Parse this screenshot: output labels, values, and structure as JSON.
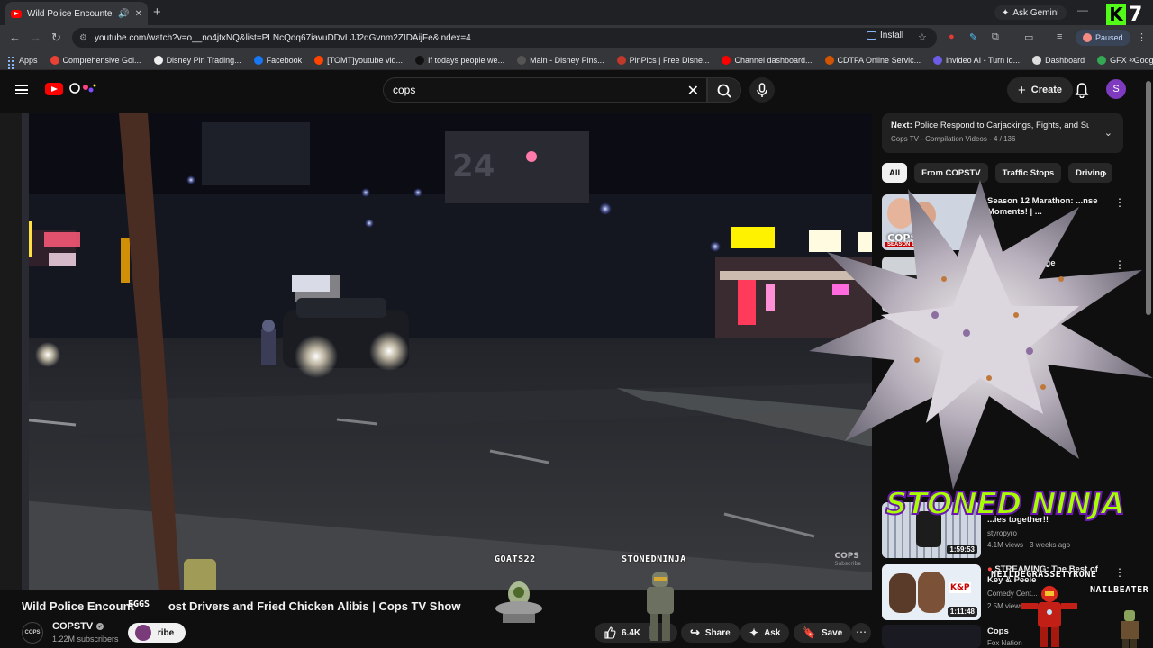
{
  "browser": {
    "tab_title": "Wild Police Encounters: Gh",
    "gemini_label": "Ask Gemini",
    "url": "youtube.com/watch?v=o__no4jtxNQ&list=PLNcQdq67iavuDDvLJJ2qGvnm2ZIDAijFe&index=4",
    "install_label": "Install",
    "paused_label": "Paused",
    "kick_count": "7",
    "bookmarks": [
      {
        "label": "Apps"
      },
      {
        "label": "Comprehensive Gol...",
        "color": "#e94235"
      },
      {
        "label": "Disney Pin Trading...",
        "color": "#eeeeee"
      },
      {
        "label": "Facebook",
        "color": "#1877f2"
      },
      {
        "label": "[TOMT]youtube vid...",
        "color": "#ff4500"
      },
      {
        "label": "If todays people we...",
        "color": "#111111"
      },
      {
        "label": "Main - Disney Pins...",
        "color": "#555555"
      },
      {
        "label": "PinPics | Free Disne...",
        "color": "#c0392b"
      },
      {
        "label": "Channel dashboard...",
        "color": "#ff0000"
      },
      {
        "label": "CDTFA Online Servic...",
        "color": "#d35400"
      },
      {
        "label": "invideo AI - Turn id...",
        "color": "#6c5ce7"
      },
      {
        "label": "Dashboard",
        "color": "#dddddd"
      },
      {
        "label": "GFX - Google Drive",
        "color": "#34a853"
      }
    ]
  },
  "youtube": {
    "search_query": "cops",
    "create_label": "Create",
    "avatar_letter": "S"
  },
  "video": {
    "title": "Wild Police Encounters: Ghost Drivers and Fried Chicken Alibis | Cops Tv Show",
    "title_display": "Wild Police Encount",
    "title_display_rest": "ost Drivers and Fried Chicken Alibis | Cops TV Show",
    "watermark": "COPS",
    "watermark_sub": "Subscribe",
    "channel_avatar_text": "COPS",
    "channel": "COPSTV",
    "subscribers": "1.22M subscribers",
    "subscribe_label": "ribe",
    "likes": "6.4K",
    "share_label": "Share",
    "ask_label": "Ask",
    "save_label": "Save"
  },
  "playlist": {
    "next_prefix": "Next:",
    "next_title": "Police Respond to Carjackings, Fights, and Su...",
    "subtitle": "Cops TV - Compilation Videos - 4 / 136"
  },
  "chips": [
    "All",
    "From COPSTV",
    "Traffic Stops",
    "Driving"
  ],
  "recommendations": [
    {
      "title": "Season 12 Marathon: ...nse Moments! | ...",
      "thumb_text": "COPS",
      "thumb_sub": "SEASON 12"
    },
    {
      "title": "Extreme ...llenge"
    },
    {
      "title": "...ies together!!",
      "channel": "styropyro",
      "meta": "4.1M views · 3 weeks ago",
      "duration": "1:59:53"
    },
    {
      "title": "STREAMING: The Best of Key & Peele",
      "channel": "Comedy Cent...",
      "meta": "2.5M views · ...ars ago",
      "duration": "1:11:48",
      "thumb_text": "K&P"
    },
    {
      "title": "Cops",
      "channel": "Fox Nation"
    }
  ],
  "overlays": {
    "banner": "STONED NINJA",
    "stoned_name": "STONEDNINJA",
    "goat_name": "GOATS22",
    "neil_name": "NEILDEGRASSETYRONE",
    "nail_name": "NAILBEATER",
    "eggs": "EGGS"
  }
}
